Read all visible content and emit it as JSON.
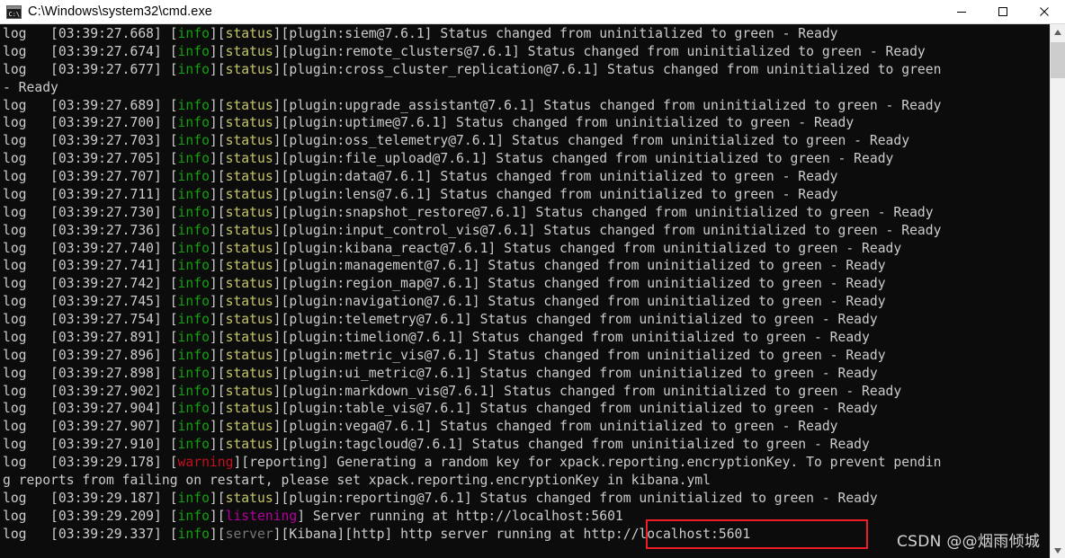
{
  "window": {
    "title": "C:\\Windows\\system32\\cmd.exe",
    "icon": "cmd-console-icon",
    "background_color": "#0c0c0c",
    "titlebar_color": "#ffffff",
    "controls": {
      "minimize_label": "Minimize",
      "maximize_label": "Maximize",
      "close_label": "Close"
    }
  },
  "colors": {
    "text_default": "#cccccc",
    "info": "#13a10e",
    "status": "#c5c56a",
    "warning": "#c50f1f",
    "listening": "#b4009e",
    "server": "#767676",
    "annotation_box": "#ee1c25"
  },
  "scrollbar": {
    "up_arrow": "scroll-up-arrow-icon",
    "down_arrow": "scroll-down-arrow-icon",
    "thumb_position_pct": 3
  },
  "annotation": {
    "highlight_text": "http://localhost:5601",
    "box_color": "#ee1c25"
  },
  "watermark": {
    "text": "CSDN @@烟雨倾城"
  },
  "console": {
    "lines": [
      {
        "tokens": [
          {
            "text": "log   [03:39:27.668] [",
            "c": "t-default"
          },
          {
            "text": "info",
            "c": "t-info"
          },
          {
            "text": "][",
            "c": "t-default"
          },
          {
            "text": "status",
            "c": "t-status"
          },
          {
            "text": "][plugin:siem@7.6.1] Status changed from uninitialized to green - Ready",
            "c": "t-default"
          }
        ]
      },
      {
        "tokens": [
          {
            "text": "log   [03:39:27.674] [",
            "c": "t-default"
          },
          {
            "text": "info",
            "c": "t-info"
          },
          {
            "text": "][",
            "c": "t-default"
          },
          {
            "text": "status",
            "c": "t-status"
          },
          {
            "text": "][plugin:remote_clusters@7.6.1] Status changed from uninitialized to green - Ready",
            "c": "t-default"
          }
        ]
      },
      {
        "tokens": [
          {
            "text": "log   [03:39:27.677] [",
            "c": "t-default"
          },
          {
            "text": "info",
            "c": "t-info"
          },
          {
            "text": "][",
            "c": "t-default"
          },
          {
            "text": "status",
            "c": "t-status"
          },
          {
            "text": "][plugin:cross_cluster_replication@7.6.1] Status changed from uninitialized to green",
            "c": "t-default"
          }
        ]
      },
      {
        "tokens": [
          {
            "text": "- Ready",
            "c": "t-default"
          }
        ]
      },
      {
        "tokens": [
          {
            "text": "log   [03:39:27.689] [",
            "c": "t-default"
          },
          {
            "text": "info",
            "c": "t-info"
          },
          {
            "text": "][",
            "c": "t-default"
          },
          {
            "text": "status",
            "c": "t-status"
          },
          {
            "text": "][plugin:upgrade_assistant@7.6.1] Status changed from uninitialized to green - Ready",
            "c": "t-default"
          }
        ]
      },
      {
        "tokens": [
          {
            "text": "log   [03:39:27.700] [",
            "c": "t-default"
          },
          {
            "text": "info",
            "c": "t-info"
          },
          {
            "text": "][",
            "c": "t-default"
          },
          {
            "text": "status",
            "c": "t-status"
          },
          {
            "text": "][plugin:uptime@7.6.1] Status changed from uninitialized to green - Ready",
            "c": "t-default"
          }
        ]
      },
      {
        "tokens": [
          {
            "text": "log   [03:39:27.703] [",
            "c": "t-default"
          },
          {
            "text": "info",
            "c": "t-info"
          },
          {
            "text": "][",
            "c": "t-default"
          },
          {
            "text": "status",
            "c": "t-status"
          },
          {
            "text": "][plugin:oss_telemetry@7.6.1] Status changed from uninitialized to green - Ready",
            "c": "t-default"
          }
        ]
      },
      {
        "tokens": [
          {
            "text": "log   [03:39:27.705] [",
            "c": "t-default"
          },
          {
            "text": "info",
            "c": "t-info"
          },
          {
            "text": "][",
            "c": "t-default"
          },
          {
            "text": "status",
            "c": "t-status"
          },
          {
            "text": "][plugin:file_upload@7.6.1] Status changed from uninitialized to green - Ready",
            "c": "t-default"
          }
        ]
      },
      {
        "tokens": [
          {
            "text": "log   [03:39:27.707] [",
            "c": "t-default"
          },
          {
            "text": "info",
            "c": "t-info"
          },
          {
            "text": "][",
            "c": "t-default"
          },
          {
            "text": "status",
            "c": "t-status"
          },
          {
            "text": "][plugin:data@7.6.1] Status changed from uninitialized to green - Ready",
            "c": "t-default"
          }
        ]
      },
      {
        "tokens": [
          {
            "text": "log   [03:39:27.711] [",
            "c": "t-default"
          },
          {
            "text": "info",
            "c": "t-info"
          },
          {
            "text": "][",
            "c": "t-default"
          },
          {
            "text": "status",
            "c": "t-status"
          },
          {
            "text": "][plugin:lens@7.6.1] Status changed from uninitialized to green - Ready",
            "c": "t-default"
          }
        ]
      },
      {
        "tokens": [
          {
            "text": "log   [03:39:27.730] [",
            "c": "t-default"
          },
          {
            "text": "info",
            "c": "t-info"
          },
          {
            "text": "][",
            "c": "t-default"
          },
          {
            "text": "status",
            "c": "t-status"
          },
          {
            "text": "][plugin:snapshot_restore@7.6.1] Status changed from uninitialized to green - Ready",
            "c": "t-default"
          }
        ]
      },
      {
        "tokens": [
          {
            "text": "log   [03:39:27.736] [",
            "c": "t-default"
          },
          {
            "text": "info",
            "c": "t-info"
          },
          {
            "text": "][",
            "c": "t-default"
          },
          {
            "text": "status",
            "c": "t-status"
          },
          {
            "text": "][plugin:input_control_vis@7.6.1] Status changed from uninitialized to green - Ready",
            "c": "t-default"
          }
        ]
      },
      {
        "tokens": [
          {
            "text": "log   [03:39:27.740] [",
            "c": "t-default"
          },
          {
            "text": "info",
            "c": "t-info"
          },
          {
            "text": "][",
            "c": "t-default"
          },
          {
            "text": "status",
            "c": "t-status"
          },
          {
            "text": "][plugin:kibana_react@7.6.1] Status changed from uninitialized to green - Ready",
            "c": "t-default"
          }
        ]
      },
      {
        "tokens": [
          {
            "text": "log   [03:39:27.741] [",
            "c": "t-default"
          },
          {
            "text": "info",
            "c": "t-info"
          },
          {
            "text": "][",
            "c": "t-default"
          },
          {
            "text": "status",
            "c": "t-status"
          },
          {
            "text": "][plugin:management@7.6.1] Status changed from uninitialized to green - Ready",
            "c": "t-default"
          }
        ]
      },
      {
        "tokens": [
          {
            "text": "log   [03:39:27.742] [",
            "c": "t-default"
          },
          {
            "text": "info",
            "c": "t-info"
          },
          {
            "text": "][",
            "c": "t-default"
          },
          {
            "text": "status",
            "c": "t-status"
          },
          {
            "text": "][plugin:region_map@7.6.1] Status changed from uninitialized to green - Ready",
            "c": "t-default"
          }
        ]
      },
      {
        "tokens": [
          {
            "text": "log   [03:39:27.745] [",
            "c": "t-default"
          },
          {
            "text": "info",
            "c": "t-info"
          },
          {
            "text": "][",
            "c": "t-default"
          },
          {
            "text": "status",
            "c": "t-status"
          },
          {
            "text": "][plugin:navigation@7.6.1] Status changed from uninitialized to green - Ready",
            "c": "t-default"
          }
        ]
      },
      {
        "tokens": [
          {
            "text": "log   [03:39:27.754] [",
            "c": "t-default"
          },
          {
            "text": "info",
            "c": "t-info"
          },
          {
            "text": "][",
            "c": "t-default"
          },
          {
            "text": "status",
            "c": "t-status"
          },
          {
            "text": "][plugin:telemetry@7.6.1] Status changed from uninitialized to green - Ready",
            "c": "t-default"
          }
        ]
      },
      {
        "tokens": [
          {
            "text": "log   [03:39:27.891] [",
            "c": "t-default"
          },
          {
            "text": "info",
            "c": "t-info"
          },
          {
            "text": "][",
            "c": "t-default"
          },
          {
            "text": "status",
            "c": "t-status"
          },
          {
            "text": "][plugin:timelion@7.6.1] Status changed from uninitialized to green - Ready",
            "c": "t-default"
          }
        ]
      },
      {
        "tokens": [
          {
            "text": "log   [03:39:27.896] [",
            "c": "t-default"
          },
          {
            "text": "info",
            "c": "t-info"
          },
          {
            "text": "][",
            "c": "t-default"
          },
          {
            "text": "status",
            "c": "t-status"
          },
          {
            "text": "][plugin:metric_vis@7.6.1] Status changed from uninitialized to green - Ready",
            "c": "t-default"
          }
        ]
      },
      {
        "tokens": [
          {
            "text": "log   [03:39:27.898] [",
            "c": "t-default"
          },
          {
            "text": "info",
            "c": "t-info"
          },
          {
            "text": "][",
            "c": "t-default"
          },
          {
            "text": "status",
            "c": "t-status"
          },
          {
            "text": "][plugin:ui_metric@7.6.1] Status changed from uninitialized to green - Ready",
            "c": "t-default"
          }
        ]
      },
      {
        "tokens": [
          {
            "text": "log   [03:39:27.902] [",
            "c": "t-default"
          },
          {
            "text": "info",
            "c": "t-info"
          },
          {
            "text": "][",
            "c": "t-default"
          },
          {
            "text": "status",
            "c": "t-status"
          },
          {
            "text": "][plugin:markdown_vis@7.6.1] Status changed from uninitialized to green - Ready",
            "c": "t-default"
          }
        ]
      },
      {
        "tokens": [
          {
            "text": "log   [03:39:27.904] [",
            "c": "t-default"
          },
          {
            "text": "info",
            "c": "t-info"
          },
          {
            "text": "][",
            "c": "t-default"
          },
          {
            "text": "status",
            "c": "t-status"
          },
          {
            "text": "][plugin:table_vis@7.6.1] Status changed from uninitialized to green - Ready",
            "c": "t-default"
          }
        ]
      },
      {
        "tokens": [
          {
            "text": "log   [03:39:27.907] [",
            "c": "t-default"
          },
          {
            "text": "info",
            "c": "t-info"
          },
          {
            "text": "][",
            "c": "t-default"
          },
          {
            "text": "status",
            "c": "t-status"
          },
          {
            "text": "][plugin:vega@7.6.1] Status changed from uninitialized to green - Ready",
            "c": "t-default"
          }
        ]
      },
      {
        "tokens": [
          {
            "text": "log   [03:39:27.910] [",
            "c": "t-default"
          },
          {
            "text": "info",
            "c": "t-info"
          },
          {
            "text": "][",
            "c": "t-default"
          },
          {
            "text": "status",
            "c": "t-status"
          },
          {
            "text": "][plugin:tagcloud@7.6.1] Status changed from uninitialized to green - Ready",
            "c": "t-default"
          }
        ]
      },
      {
        "tokens": [
          {
            "text": "log   [03:39:29.178] [",
            "c": "t-default"
          },
          {
            "text": "warning",
            "c": "t-warning"
          },
          {
            "text": "][reporting] Generating a random key for xpack.reporting.encryptionKey. To prevent pendin",
            "c": "t-default"
          }
        ]
      },
      {
        "tokens": [
          {
            "text": "g reports from failing on restart, please set xpack.reporting.encryptionKey in kibana.yml",
            "c": "t-default"
          }
        ]
      },
      {
        "tokens": [
          {
            "text": "log   [03:39:29.187] [",
            "c": "t-default"
          },
          {
            "text": "info",
            "c": "t-info"
          },
          {
            "text": "][",
            "c": "t-default"
          },
          {
            "text": "status",
            "c": "t-status"
          },
          {
            "text": "][plugin:reporting@7.6.1] Status changed from uninitialized to green - Ready",
            "c": "t-default"
          }
        ]
      },
      {
        "tokens": [
          {
            "text": "log   [03:39:29.209] [",
            "c": "t-default"
          },
          {
            "text": "info",
            "c": "t-info"
          },
          {
            "text": "][",
            "c": "t-default"
          },
          {
            "text": "listening",
            "c": "t-listen"
          },
          {
            "text": "] Server running at http://localhost:5601",
            "c": "t-default"
          }
        ]
      },
      {
        "tokens": [
          {
            "text": "log   [03:39:29.337] [",
            "c": "t-default"
          },
          {
            "text": "info",
            "c": "t-info"
          },
          {
            "text": "][",
            "c": "t-default"
          },
          {
            "text": "server",
            "c": "t-server"
          },
          {
            "text": "][Kibana][http] http server running at http://localhost:5601",
            "c": "t-default"
          }
        ]
      }
    ]
  }
}
